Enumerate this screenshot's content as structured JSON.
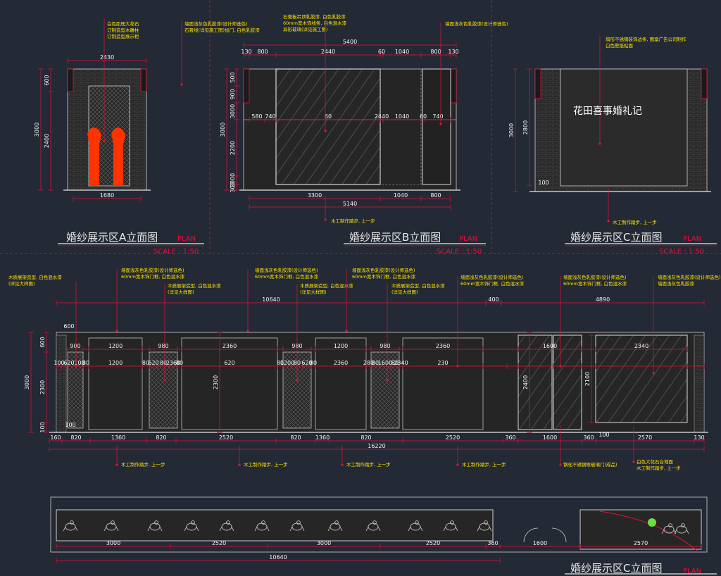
{
  "titles": {
    "a": "婚纱展示区A立面图",
    "b": "婚纱展示区B立面图",
    "c": "婚纱展示区C立面图",
    "bottom": "婚纱展示区C立面图",
    "plan": "PLAN",
    "scale": "SCALE : 1:50"
  },
  "sign_text": "花田喜事婚礼记",
  "notes": {
    "a": [
      "白色肌理大花石",
      "订制造型木雕柱",
      "订制造型展示柜"
    ],
    "b1": [
      "墙面浅灰色乳胶漆(设计师选色)",
      "石膏线(详见施工图)加门, 白色乳胶漆"
    ],
    "b2": [
      "石膏板吊顶乳胶漆, 白色乳胶漆",
      "60mm宽木饰线条, 白色混水漆",
      "异形玻璃(详见施工图)"
    ],
    "b3": [
      "墙面浅灰色乳胶漆(设计师选色)"
    ],
    "c": [
      "扇形不锈钢装饰边条, 图案广告公司制作",
      "白色壁纸贴面"
    ],
    "floor": "木工制作踏步, 上一步",
    "bottom_left": [
      "木质展架造型, 白色混水漆",
      "(详见大样图)"
    ],
    "bottom_n1": [
      "墙面浅灰色乳胶漆(设计师选色)",
      "60mm宽木饰门框, 白色混水漆",
      "木质展架造型, 白色混水漆",
      "(详见大样图)"
    ],
    "bottom_n2": [
      "墙面浅灰色乳胶漆(设计师选色)",
      "60mm宽木饰门框, 白色混水漆",
      "木质展架造型, 白色混水漆",
      "(详见大样图)"
    ],
    "bottom_n3": [
      "墙面浅灰色乳胶漆(设计师选色)",
      "60mm宽木饰门框, 白色混水漆",
      "木质展架造型, 白色混水漆",
      "(详见大样图)"
    ],
    "bottom_n4": [
      "墙面浅灰色乳胶漆(设计师选色)",
      "60mm宽木饰门框, 白色混水漆"
    ],
    "bottom_n5": [
      "墙面浅灰色乳胶漆(设计师选色)",
      "60mm宽木饰门框, 白色混水漆"
    ],
    "bottom_n6": [
      "墙面浅灰色乳胶漆(设计师选色)",
      "墙面浅灰色乳胶漆"
    ],
    "glass_door": "钢化不锈钢框玻璃门(成品)",
    "stone": [
      "白色大花石台地面",
      "木工制作踏步, 上一步"
    ]
  },
  "dims": {
    "a_top": "2430",
    "a_bottom": "1680",
    "a_left": [
      "600",
      "3000",
      "2400"
    ],
    "b_top": [
      "130",
      "800",
      "2440",
      "60",
      "1040",
      "800",
      "130"
    ],
    "b_total": "5400",
    "b_mid": [
      "580",
      "740",
      "60",
      "2440",
      "1040",
      "60",
      "740"
    ],
    "b_left": [
      "500",
      "900",
      "3000",
      "2200",
      "2000",
      "300",
      "100"
    ],
    "b_bottom": [
      "3300",
      "1040",
      "800"
    ],
    "b_bottom_total": "5140",
    "c_left": [
      "3000",
      "2800",
      "100"
    ],
    "main_top": [
      "10640",
      "400",
      "4890"
    ],
    "main_row1": [
      "900",
      "1200",
      "980",
      "2360",
      "980",
      "1200",
      "980",
      "2360",
      "1600",
      "2340"
    ],
    "main_row2": [
      "100",
      "620",
      "100",
      "80",
      "1200",
      "80",
      "620",
      "80",
      "2360",
      "80",
      "620",
      "80",
      "1200",
      "80",
      "620",
      "80",
      "2360",
      "280",
      "80",
      "1600",
      "80",
      "2340",
      "230"
    ],
    "main_row3": [
      "160",
      "820",
      "1360",
      "820",
      "2520",
      "820",
      "1360",
      "820",
      "2520",
      "360",
      "1600",
      "360",
      "2570",
      "130"
    ],
    "main_total": "16220",
    "main_left": [
      "3000",
      "600",
      "2300",
      "100"
    ],
    "main_side": [
      "600",
      "2300",
      "2400",
      "2100",
      "100"
    ],
    "plan_row": [
      "3000",
      "2520",
      "3000",
      "2520",
      "360",
      "1600",
      "2570"
    ],
    "plan_total": "10640"
  },
  "colors": {
    "background": "#232935",
    "dim_line": "#e0143c",
    "wall": "#c8c8c8",
    "note": "#ffe400",
    "ornament": "#ff3300"
  }
}
